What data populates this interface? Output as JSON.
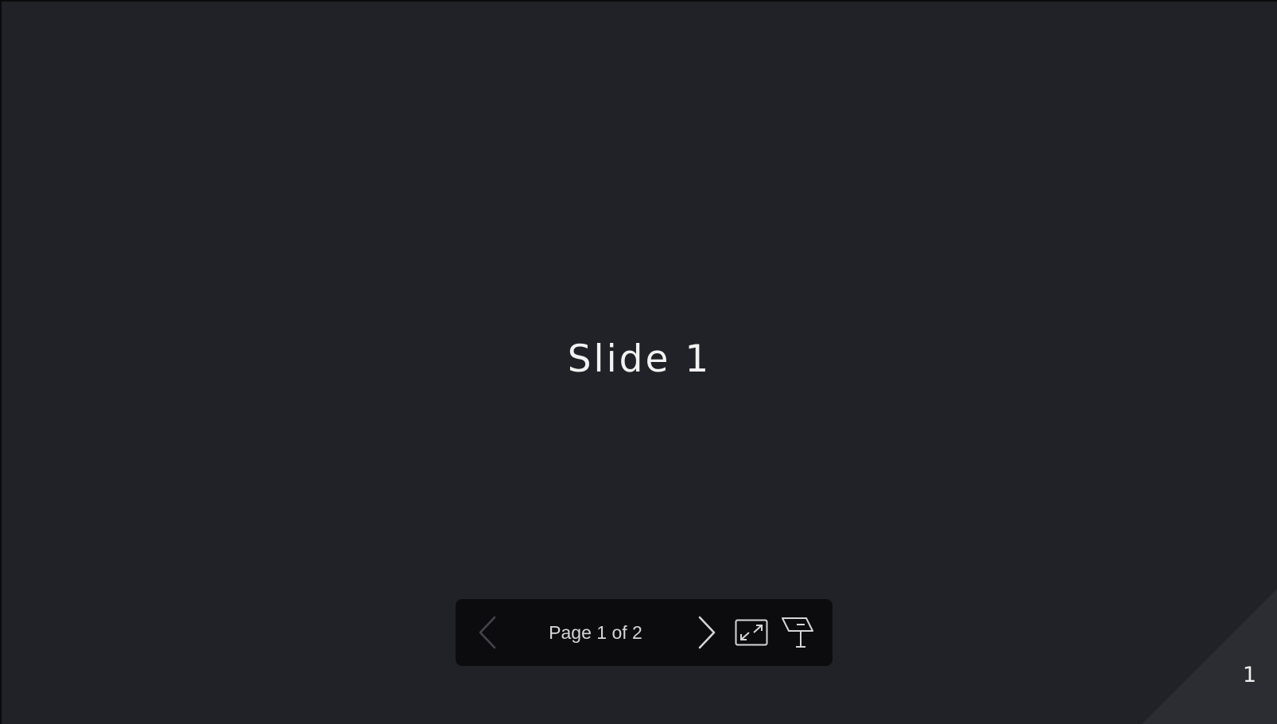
{
  "slide": {
    "title": "Slide 1",
    "number": "1"
  },
  "toolbar": {
    "page_indicator": "Page 1 of 2",
    "prev_icon": "chevron-left-icon",
    "next_icon": "chevron-right-icon",
    "fullscreen_icon": "expand-icon",
    "present_icon": "presenter-podium-icon"
  },
  "colors": {
    "slide_background": "#212227",
    "toolbar_background": "#0c0c0e",
    "disabled_icon": "#45464c",
    "enabled_icon": "#d6d6d6"
  }
}
